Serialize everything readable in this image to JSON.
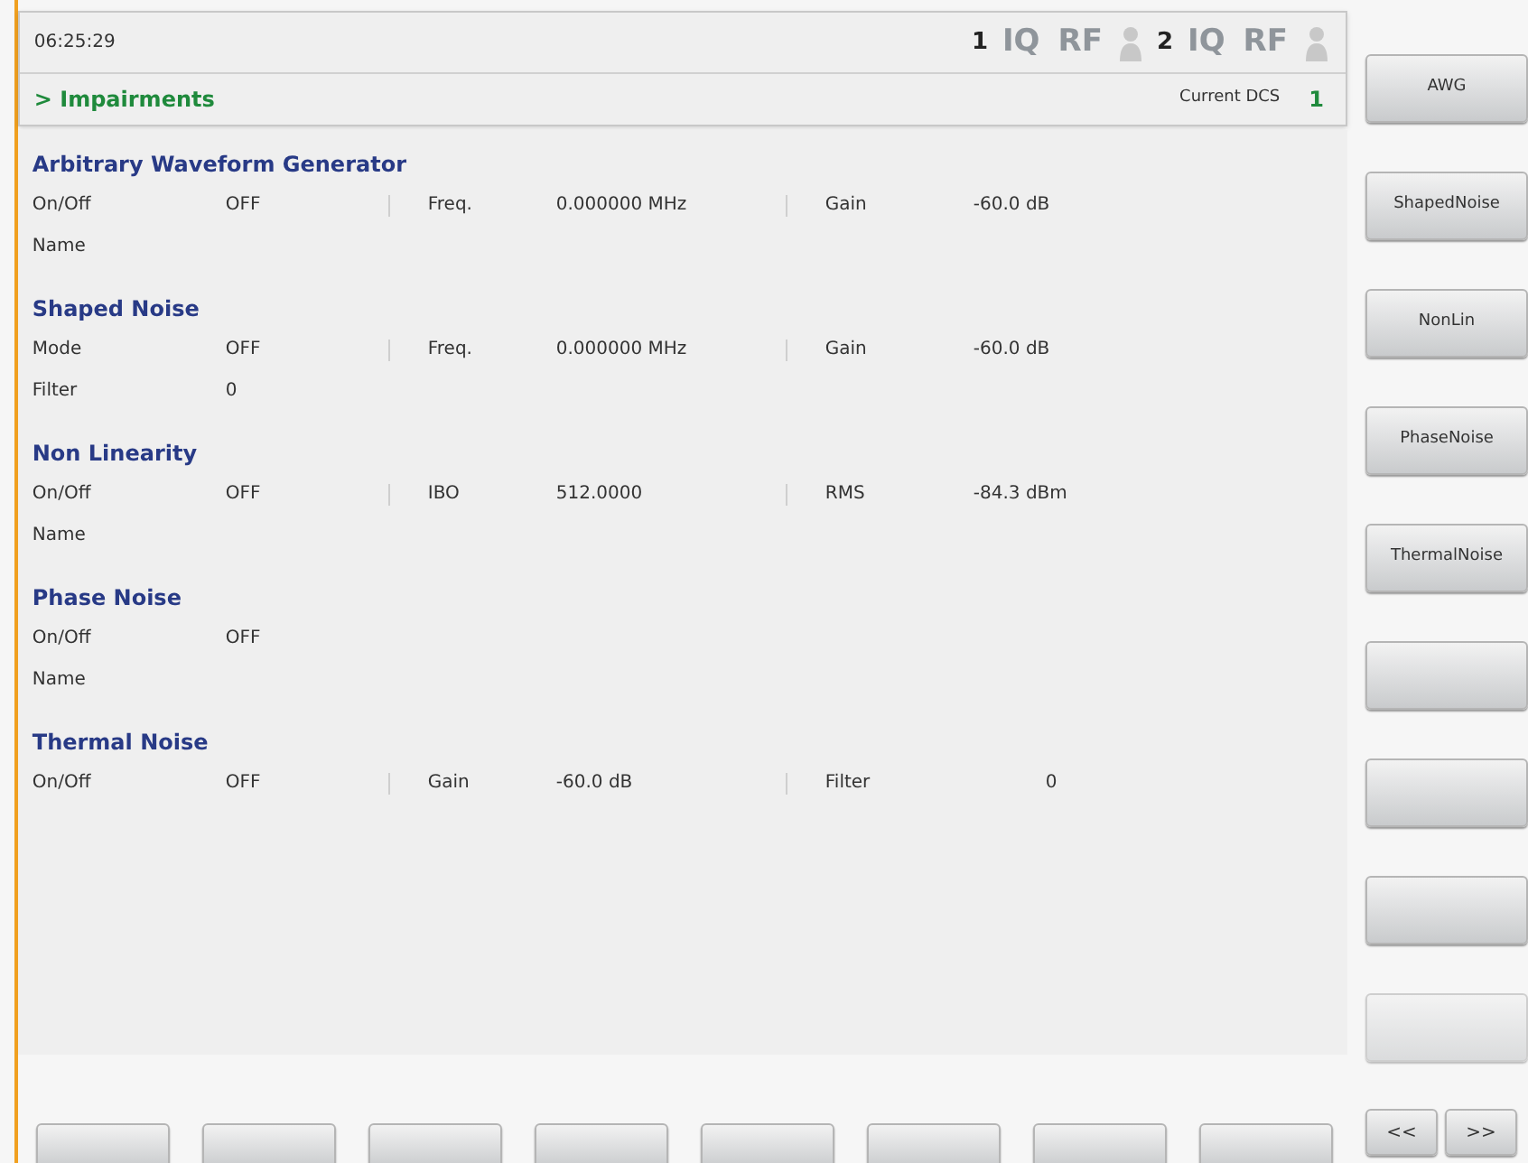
{
  "status_bar": {
    "time": "06:25:29",
    "units": [
      {
        "number": "1",
        "indicators": [
          {
            "kind": "text",
            "text": "IQ",
            "enabled": false
          },
          {
            "kind": "text",
            "text": "RF",
            "enabled": false
          },
          {
            "kind": "figure",
            "enabled": false
          }
        ]
      },
      {
        "number": "2",
        "indicators": [
          {
            "kind": "text",
            "text": "IQ",
            "enabled": false
          },
          {
            "kind": "text",
            "text": "RF",
            "enabled": false
          },
          {
            "kind": "figure",
            "enabled": false
          }
        ]
      }
    ]
  },
  "breadcrumb": "> Impairments",
  "current_dcs": {
    "label": "Current DCS",
    "value": "1"
  },
  "sections": [
    {
      "title": "Arbitrary Waveform Generator",
      "rows": [
        [
          {
            "label": "On/Off",
            "value": "OFF"
          },
          {
            "label": "Freq.",
            "value": "0.000000 MHz"
          },
          {
            "label": "Gain",
            "value": "-60.0 dB"
          }
        ],
        [
          {
            "label": "Name"
          }
        ]
      ]
    },
    {
      "title": "Shaped Noise",
      "rows": [
        [
          {
            "label": "Mode",
            "value": "OFF"
          },
          {
            "label": "Freq.",
            "value": "0.000000 MHz"
          },
          {
            "label": "Gain",
            "value": "-60.0 dB"
          }
        ],
        [
          {
            "label": "Filter",
            "value": "0"
          }
        ]
      ]
    },
    {
      "title": "Non Linearity",
      "rows": [
        [
          {
            "label": "On/Off",
            "value": "OFF"
          },
          {
            "label": "IBO",
            "value": "512.0000"
          },
          {
            "label": "RMS",
            "value": "-84.3 dBm"
          }
        ],
        [
          {
            "label": "Name"
          }
        ]
      ]
    },
    {
      "title": "Phase Noise",
      "rows": [
        [
          {
            "label": "On/Off",
            "value": "OFF"
          }
        ],
        [
          {
            "label": "Name"
          }
        ]
      ]
    },
    {
      "title": "Thermal Noise",
      "rows": [
        [
          {
            "label": "On/Off",
            "value": "OFF"
          },
          {
            "label": "Gain",
            "value": "-60.0 dB"
          },
          {
            "label": "Filter",
            "value": "0"
          }
        ]
      ]
    }
  ],
  "side_buttons": [
    {
      "label": "AWG",
      "disabled": false
    },
    {
      "label": "ShapedNoise",
      "disabled": false
    },
    {
      "label": "NonLin",
      "disabled": false
    },
    {
      "label": "PhaseNoise",
      "disabled": false
    },
    {
      "label": "ThermalNoise",
      "disabled": false
    },
    {
      "disabled": false
    },
    {
      "disabled": false
    },
    {
      "disabled": false
    },
    {
      "disabled": true
    }
  ],
  "bottom_buttons": [
    {
      "disabled": false
    },
    {
      "disabled": false
    },
    {
      "disabled": false
    },
    {
      "disabled": false
    },
    {
      "disabled": false
    },
    {
      "disabled": false
    },
    {
      "disabled": false
    },
    {
      "disabled": false
    }
  ],
  "nav_buttons": [
    "<<",
    ">>"
  ]
}
